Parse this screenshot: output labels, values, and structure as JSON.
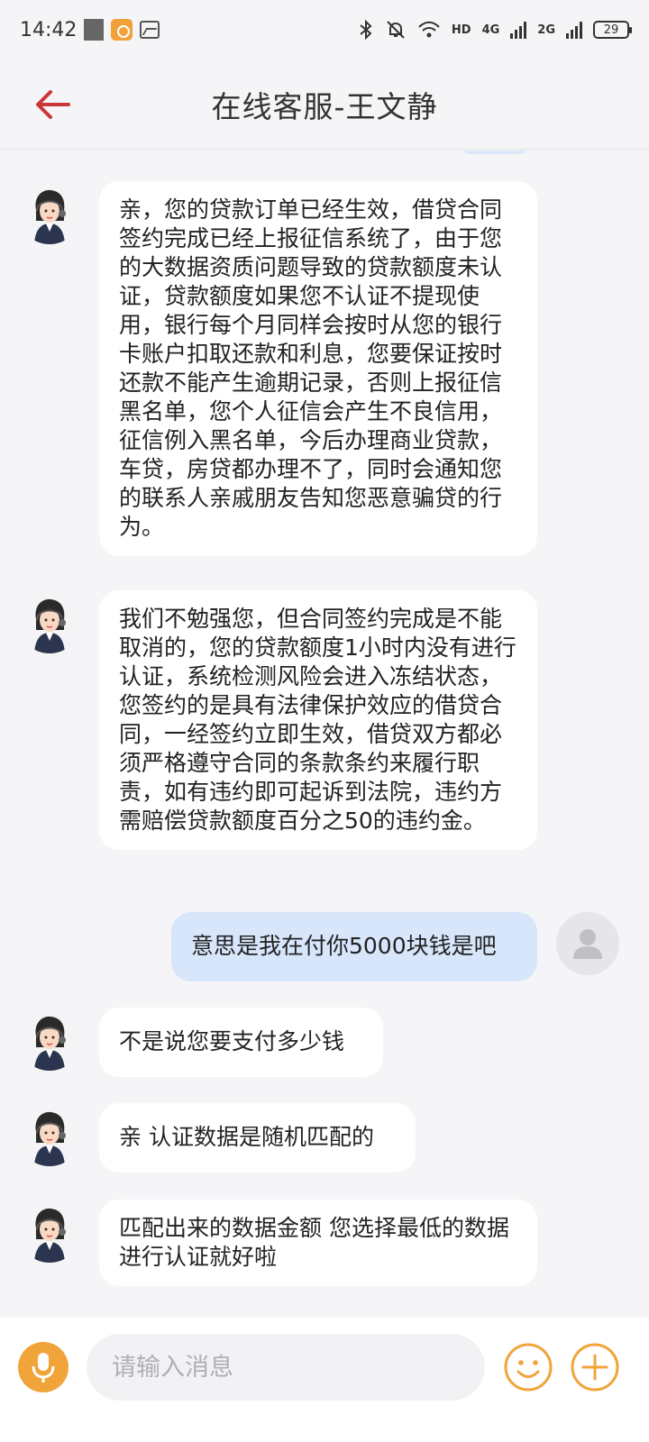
{
  "status_bar": {
    "time": "14:42",
    "network_1": "HD",
    "network_2": "4G",
    "network_3": "2G",
    "battery": "29"
  },
  "header": {
    "title": "在线客服-王文静"
  },
  "colors": {
    "accent": "#f0a43a",
    "back_arrow": "#c8373a",
    "my_bubble": "#d7e6fb",
    "their_bubble": "#ffffff",
    "background": "#f5f5f7"
  },
  "messages": [
    {
      "sender": "agent",
      "text": "亲，您的贷款订单已经生效，借贷合同签约完成已经上报征信系统了，由于您的大数据资质问题导致的贷款额度未认证，贷款额度如果您不认证不提现使用，银行每个月同样会按时从您的银行卡账户扣取还款和利息，您要保证按时还款不能产生逾期记录，否则上报征信黑名单，您个人征信会产生不良信用，征信例入黑名单，今后办理商业贷款，车贷，房贷都办理不了，同时会通知您的联系人亲戚朋友告知您恶意骗贷的行为。"
    },
    {
      "sender": "agent",
      "text": "我们不勉强您，但合同签约完成是不能取消的，您的贷款额度1小时内没有进行认证，系统检测风险会进入冻结状态，您签约的是具有法律保护效应的借贷合同，一经签约立即生效，借贷双方都必须严格遵守合同的条款条约来履行职责，如有违约即可起诉到法院，违约方需赔偿贷款额度百分之50的违约金。"
    },
    {
      "sender": "me",
      "text": "意思是我在付你5000块钱是吧"
    },
    {
      "sender": "agent",
      "text": "不是说您要支付多少钱"
    },
    {
      "sender": "agent",
      "text": "亲 认证数据是随机匹配的"
    },
    {
      "sender": "agent",
      "text": "匹配出来的数据金额 您选择最低的数据进行认证就好啦"
    }
  ],
  "input": {
    "placeholder": "请输入消息",
    "value": ""
  },
  "icons": {
    "back": "back-arrow-icon",
    "mic": "microphone-icon",
    "emoji": "emoji-icon",
    "plus": "plus-icon",
    "agent_avatar": "agent-avatar",
    "user_avatar": "user-avatar"
  }
}
